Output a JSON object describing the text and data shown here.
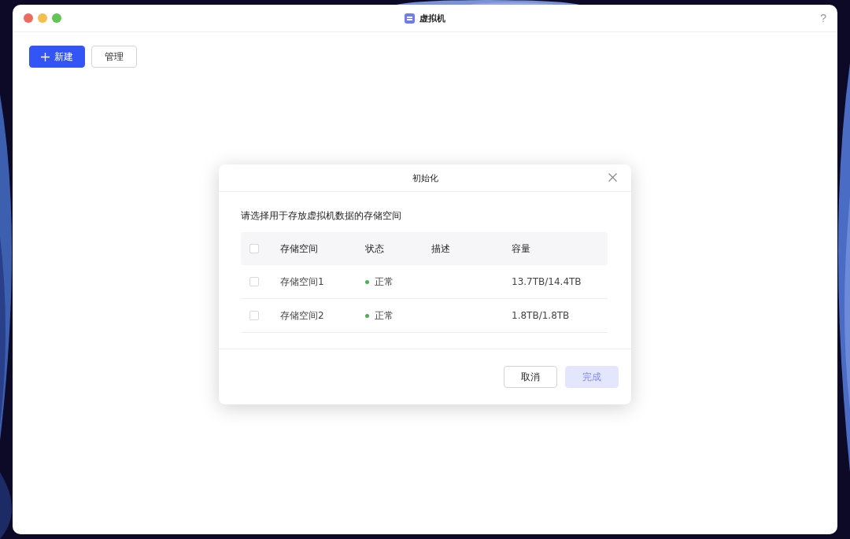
{
  "window": {
    "title": "虚拟机",
    "help": "?"
  },
  "toolbar": [
    {
      "label": "新建",
      "kind": "primary"
    },
    {
      "label": "管理",
      "kind": "secondary"
    }
  ],
  "dialog": {
    "title": "初始化",
    "prompt": "请选择用于存放虚拟机数据的存储空间",
    "table": {
      "header_checked": false,
      "columns": [
        "存储空间",
        "状态",
        "描述",
        "容量"
      ],
      "rows": [
        {
          "checked": false,
          "name": "存储空间1",
          "status": "正常",
          "color": "#4caf50",
          "capacity": "13.7TB/14.4TB"
        },
        {
          "checked": false,
          "name": "存储空间2",
          "status": "正常",
          "color": "#4caf50",
          "capacity": "1.8TB/1.8TB"
        }
      ]
    },
    "buttons": [
      {
        "label": "取消",
        "kind": "secondary",
        "disabled": false
      },
      {
        "label": "完成",
        "kind": "primary",
        "disabled": true
      }
    ]
  }
}
